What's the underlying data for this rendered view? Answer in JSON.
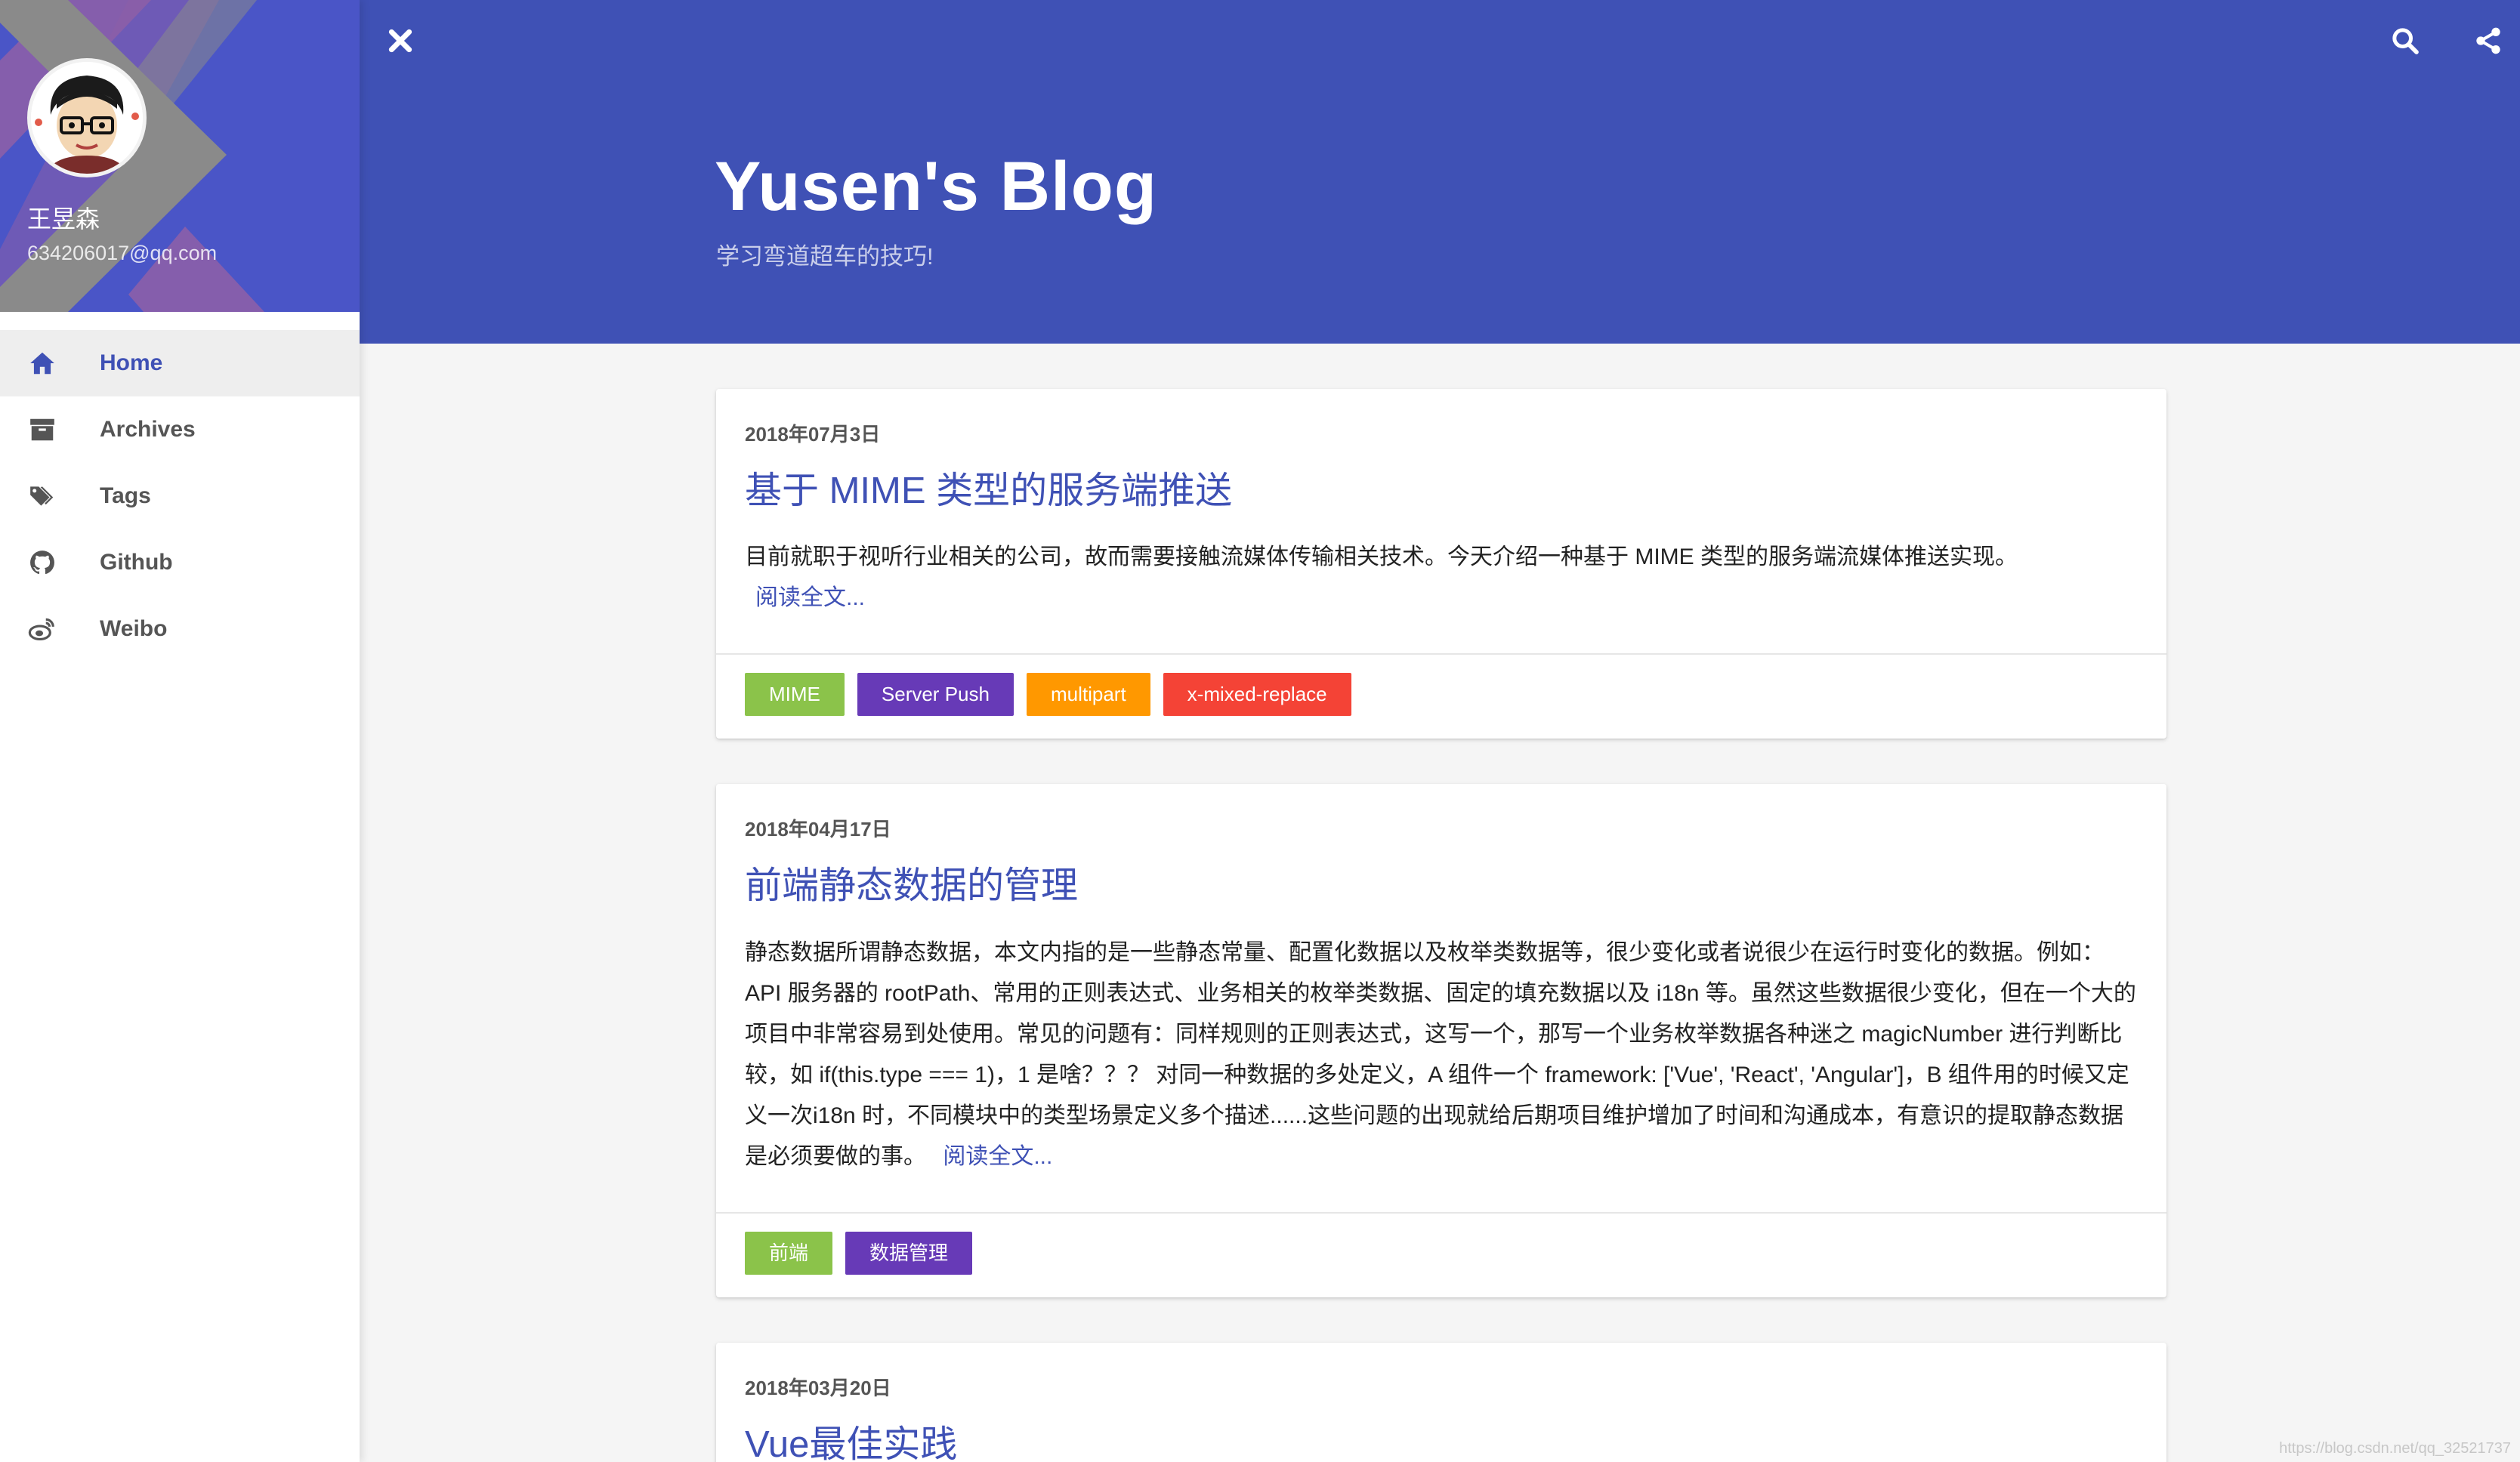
{
  "sidebar": {
    "profile": {
      "name": "王昱森",
      "email": "634206017@qq.com"
    },
    "nav": [
      {
        "label": "Home",
        "icon": "home-icon",
        "active": true
      },
      {
        "label": "Archives",
        "icon": "archive-icon",
        "active": false
      },
      {
        "label": "Tags",
        "icon": "tags-icon",
        "active": false
      },
      {
        "label": "Github",
        "icon": "github-icon",
        "active": false
      },
      {
        "label": "Weibo",
        "icon": "weibo-icon",
        "active": false
      }
    ]
  },
  "header": {
    "title": "Yusen's Blog",
    "subtitle": "学习弯道超车的技巧!",
    "icons": [
      "close-icon",
      "search-icon",
      "share-icon"
    ]
  },
  "posts": [
    {
      "date": "2018年07月3日",
      "title": "基于 MIME 类型的服务端推送",
      "excerpt": "目前就职于视听行业相关的公司，故而需要接触流媒体传输相关技术。今天介绍一种基于 MIME 类型的服务端流媒体推送实现。",
      "read_more": "阅读全文...",
      "tags": [
        {
          "label": "MIME",
          "color": "#8bc34a"
        },
        {
          "label": "Server Push",
          "color": "#673ab7"
        },
        {
          "label": "multipart",
          "color": "#ff9800"
        },
        {
          "label": "x-mixed-replace",
          "color": "#f44336"
        }
      ]
    },
    {
      "date": "2018年04月17日",
      "title": "前端静态数据的管理",
      "excerpt": "静态数据所谓静态数据，本文内指的是一些静态常量、配置化数据以及枚举类数据等，很少变化或者说很少在运行时变化的数据。例如：API 服务器的 rootPath、常用的正则表达式、业务相关的枚举类数据、固定的填充数据以及 i18n 等。虽然这些数据很少变化，但在一个大的项目中非常容易到处使用。常见的问题有：同样规则的正则表达式，这写一个，那写一个业务枚举数据各种迷之 magicNumber 进行判断比较，如 if(this.type === 1)，1 是啥？？？ 对同一种数据的多处定义，A 组件一个 framework: ['Vue', 'React', 'Angular']，B 组件用的时候又定义一次i18n 时，不同模块中的类型场景定义多个描述......这些问题的出现就给后期项目维护增加了时间和沟通成本，有意识的提取静态数据是必须要做的事。",
      "read_more": "阅读全文...",
      "tags": [
        {
          "label": "前端",
          "color": "#8bc34a"
        },
        {
          "label": "数据管理",
          "color": "#673ab7"
        }
      ]
    },
    {
      "date": "2018年03月20日",
      "title": "Vue最佳实践"
    }
  ],
  "colors": {
    "primary": "#3f51b5",
    "sidebar_header": "#4a55c7",
    "stripe_purple": "#8c5fa8",
    "stripe_grey": "#8a8a8a",
    "background": "#f5f5f5"
  },
  "watermark": "https://blog.csdn.net/qq_32521737"
}
